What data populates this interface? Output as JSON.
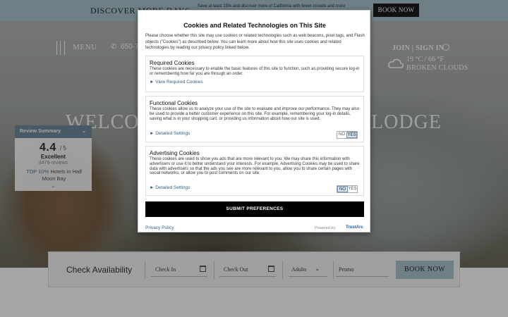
{
  "promo": {
    "title": "DISCOVER MORE DAYS",
    "subtitle": "Save at least 15% and discover more of California with fewer crowds and more",
    "book_button": "BOOK NOW"
  },
  "header": {
    "menu_label": "MENU",
    "phone": "650-7",
    "account": "JOIN | SIGN IN",
    "weather_temp": "19 °C / 66 °F",
    "weather_condition": "BROKEN CLOUDS"
  },
  "hero": {
    "title_left": "WELCO",
    "title_right": "LODGE"
  },
  "review_summary": {
    "heading": "Review Summary",
    "score": "4.4",
    "max": "/ 5",
    "label": "Excellent",
    "count": "3479 reviews",
    "rank_prefix": "TOP 10%",
    "rank_text": " Hotels in Half Moon Bay"
  },
  "availability": {
    "title": "Check Availability",
    "check_in": "Check In",
    "check_out": "Check Out",
    "adults": "Adults",
    "promo": "Promo",
    "book_button": "BOOK NOW"
  },
  "cookie_dialog": {
    "title": "Cookies and Related Technologies on This Site",
    "intro": "Please choose whether this site may use cookies or related technologies such as web beacons, pixel tags, and Flash objects (\"Cookies\") as described below. You can learn more about how this site uses cookies and related technologies by reading our privacy policy linked below.",
    "panels": [
      {
        "title": "Required Cookies",
        "description": "These cookies are necessary to enable the basic features of this site to function, such as providing secure log-in or remembering how far you are through an order.",
        "link": "► View Required Cookies"
      },
      {
        "title": "Functional Cookies",
        "description": "These cookies allow us to analyze your use of the site to evaluate and improve our performance. They may also be used to provide a better customer experience on this site. For example, remembering your log-in details, saving what is in your shopping cart, or providing us information about how our site is used.",
        "link": "► Detailed Settings",
        "no": "NO",
        "yes": "YES",
        "selected": "YES"
      },
      {
        "title": "Advertising Cookies",
        "description": "These cookies are used to show you ads that are more relevant to you. We may share this information with advertisers or use it to better understand your interests. For example, Advertising Cookies may be used to share data with advertisers so that the ads you see are more relevant to you, allow you to share certain pages with social networks, or allow you to post comments on our site.",
        "link": "► Detailed Settings",
        "no": "NO",
        "yes": "YES",
        "selected": "NO"
      }
    ],
    "submit": "SUBMIT PREFERENCES",
    "privacy_link": "Privacy Policy",
    "powered_by": "Powered by:",
    "vendor": "TrustArc"
  },
  "colors": {
    "promo_bg": "#a9c4cc",
    "book_dark": "#1d1d1d",
    "review_head": "#6d8a9d",
    "link": "#2d5f8a"
  }
}
